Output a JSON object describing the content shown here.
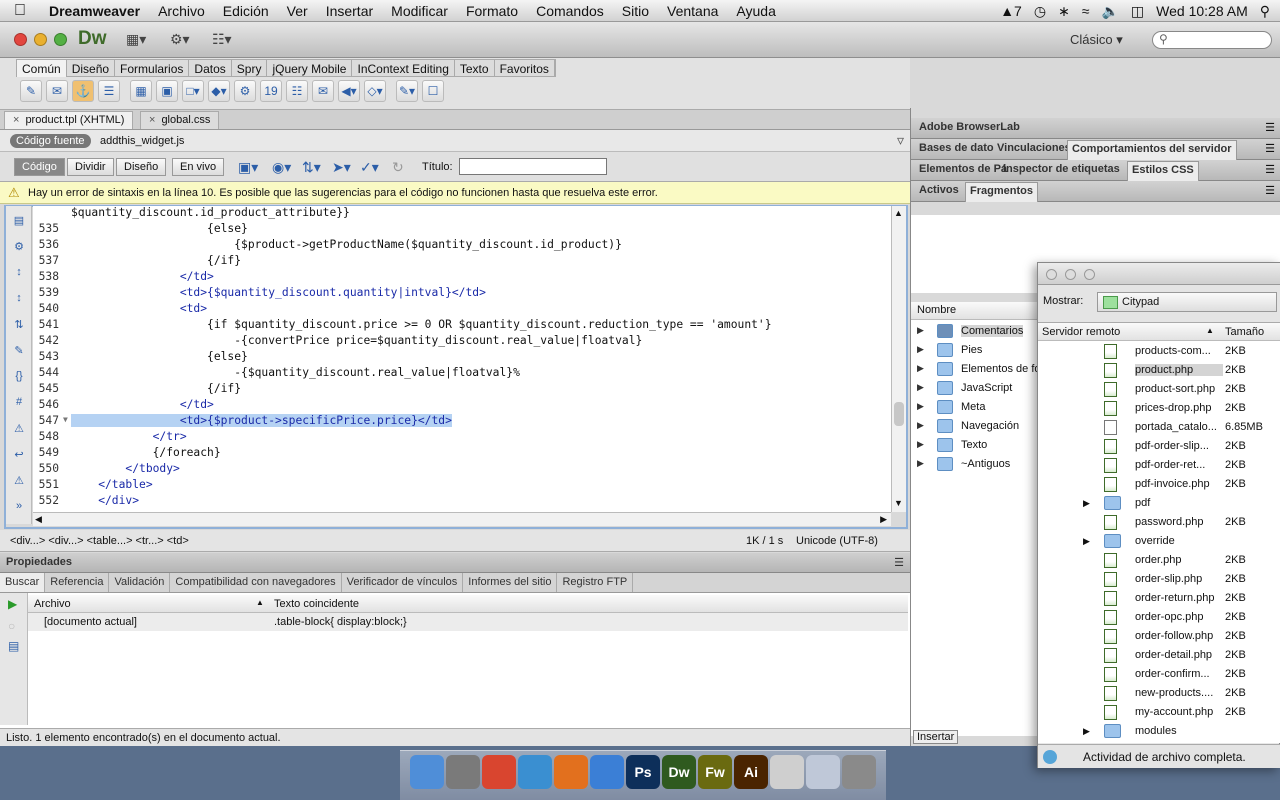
{
  "menubar": {
    "apple": "",
    "app": "Dreamweaver",
    "items": [
      "Archivo",
      "Edición",
      "Ver",
      "Insertar",
      "Modificar",
      "Formato",
      "Comandos",
      "Sitio",
      "Ventana",
      "Ayuda"
    ],
    "right": {
      "adobe": "7",
      "clock": "Wed 10:28 AM"
    }
  },
  "window": {
    "logo": "Dw",
    "workspace": "Clásico"
  },
  "insert_tabs": [
    "Común",
    "Diseño",
    "Formularios",
    "Datos",
    "Spry",
    "jQuery Mobile",
    "InContext Editing",
    "Texto",
    "Favoritos"
  ],
  "doc_tabs": [
    {
      "label": "product.tpl (XHTML)",
      "close": "×"
    },
    {
      "label": "global.css",
      "close": "×"
    }
  ],
  "related": {
    "source_label": "Código fuente",
    "file": "addthis_widget.js"
  },
  "view_buttons": [
    "Código",
    "Dividir",
    "Diseño",
    "En vivo"
  ],
  "titulo_label": "Título:",
  "warning": "Hay un error de sintaxis en la línea 10. Es posible que las sugerencias para el código no funcionen hasta que resuelva este error.",
  "code": [
    {
      "n": "",
      "t": "$quantity_discount.id_product_attribute}}"
    },
    {
      "n": "535",
      "t": "                    {else}"
    },
    {
      "n": "536",
      "t": "                        {$product->getProductName($quantity_discount.id_product)}"
    },
    {
      "n": "537",
      "t": "                    {/if}"
    },
    {
      "n": "538",
      "t": "                </td>"
    },
    {
      "n": "539",
      "t": "                <td>{$quantity_discount.quantity|intval}</td>"
    },
    {
      "n": "540",
      "t": "                <td>"
    },
    {
      "n": "541",
      "t": "                    {if $quantity_discount.price >= 0 OR $quantity_discount.reduction_type == 'amount'}"
    },
    {
      "n": "542",
      "t": "                        -{convertPrice price=$quantity_discount.real_value|floatval}"
    },
    {
      "n": "543",
      "t": "                    {else}"
    },
    {
      "n": "544",
      "t": "                        -{$quantity_discount.real_value|floatval}%"
    },
    {
      "n": "545",
      "t": "                    {/if}"
    },
    {
      "n": "546",
      "t": "                </td>"
    },
    {
      "n": "547",
      "t": "                <td>{$product->specificPrice.price}</td>"
    },
    {
      "n": "548",
      "t": "            </tr>"
    },
    {
      "n": "549",
      "t": "            {/foreach}"
    },
    {
      "n": "550",
      "t": "        </tbody>"
    },
    {
      "n": "551",
      "t": "    </table>"
    },
    {
      "n": "552",
      "t": "    </div>"
    }
  ],
  "tag_selector": "<div...> <div...> <table...> <tr...> <td>",
  "doc_status": {
    "size": "1K / 1 s",
    "encoding": "Unicode (UTF-8)"
  },
  "properties_label": "Propiedades",
  "results_tabs": [
    "Buscar",
    "Referencia",
    "Validación",
    "Compatibilidad con navegadores",
    "Verificador de vínculos",
    "Informes del sitio",
    "Registro FTP"
  ],
  "results_cols": {
    "file": "Archivo",
    "match": "Texto coincidente"
  },
  "results_row": {
    "file": "[documento actual]",
    "match": ".table-block{ display:block;}"
  },
  "results_status": "Listo. 1 elemento encontrado(s) en el documento actual.",
  "right_panels": {
    "browserlab": "Adobe BrowserLab",
    "row2": [
      "Bases de dato",
      "Vinculaciones",
      "Comportamientos del servidor"
    ],
    "row3": [
      "Elementos de Pá",
      "Inspector de etiquetas",
      "Estilos CSS"
    ],
    "row4": [
      "Activos",
      "Fragmentos"
    ],
    "nombre": "Nombre",
    "folders": [
      "Comentarios",
      "Pies",
      "Elementos de fo",
      "JavaScript",
      "Meta",
      "Navegación",
      "Texto",
      "~Antiguos"
    ],
    "insert_button": "Insertar"
  },
  "files_window": {
    "mostrar_label": "Mostrar:",
    "site": "Citypad",
    "col_name": "Servidor remoto",
    "col_size": "Tamaño",
    "files": [
      {
        "name": "products-com...",
        "size": "2KB",
        "type": "php"
      },
      {
        "name": "product.php",
        "size": "2KB",
        "type": "php",
        "selected": true
      },
      {
        "name": "product-sort.php",
        "size": "2KB",
        "type": "php"
      },
      {
        "name": "prices-drop.php",
        "size": "2KB",
        "type": "php"
      },
      {
        "name": "portada_catalo...",
        "size": "6.85MB",
        "type": "doc"
      },
      {
        "name": "pdf-order-slip...",
        "size": "2KB",
        "type": "php"
      },
      {
        "name": "pdf-order-ret...",
        "size": "2KB",
        "type": "php"
      },
      {
        "name": "pdf-invoice.php",
        "size": "2KB",
        "type": "php"
      },
      {
        "name": "pdf",
        "size": "",
        "type": "folder"
      },
      {
        "name": "password.php",
        "size": "2KB",
        "type": "php"
      },
      {
        "name": "override",
        "size": "",
        "type": "folder"
      },
      {
        "name": "order.php",
        "size": "2KB",
        "type": "php"
      },
      {
        "name": "order-slip.php",
        "size": "2KB",
        "type": "php"
      },
      {
        "name": "order-return.php",
        "size": "2KB",
        "type": "php"
      },
      {
        "name": "order-opc.php",
        "size": "2KB",
        "type": "php"
      },
      {
        "name": "order-follow.php",
        "size": "2KB",
        "type": "php"
      },
      {
        "name": "order-detail.php",
        "size": "2KB",
        "type": "php"
      },
      {
        "name": "order-confirm...",
        "size": "2KB",
        "type": "php"
      },
      {
        "name": "new-products....",
        "size": "2KB",
        "type": "php"
      },
      {
        "name": "my-account.php",
        "size": "2KB",
        "type": "php"
      },
      {
        "name": "modules",
        "size": "",
        "type": "folder"
      }
    ],
    "status": "Actividad de archivo completa."
  },
  "dock": [
    {
      "label": "",
      "icon": "finder-icon",
      "color": "#4f8ed8"
    },
    {
      "label": "",
      "icon": "launchpad-icon",
      "color": "#7a7a7a"
    },
    {
      "label": "",
      "icon": "chrome-icon",
      "color": "#d9452f"
    },
    {
      "label": "",
      "icon": "safari-icon",
      "color": "#3a8fd1"
    },
    {
      "label": "",
      "icon": "firefox-icon",
      "color": "#e2701e"
    },
    {
      "label": "",
      "icon": "itunes-icon",
      "color": "#3b7fd6"
    },
    {
      "label": "Ps",
      "icon": "photoshop-icon",
      "color": "#0d2f5a"
    },
    {
      "label": "Dw",
      "icon": "dreamweaver-icon",
      "color": "#2f5a1f"
    },
    {
      "label": "Fw",
      "icon": "fireworks-icon",
      "color": "#6a6a10"
    },
    {
      "label": "Ai",
      "icon": "illustrator-icon",
      "color": "#4a2400"
    },
    {
      "label": "",
      "icon": "documents-icon",
      "color": "#cfcfcf"
    },
    {
      "label": "",
      "icon": "preview-icon",
      "color": "#bfc8d8"
    },
    {
      "label": "",
      "icon": "trash-icon",
      "color": "#8a8a8a"
    }
  ]
}
